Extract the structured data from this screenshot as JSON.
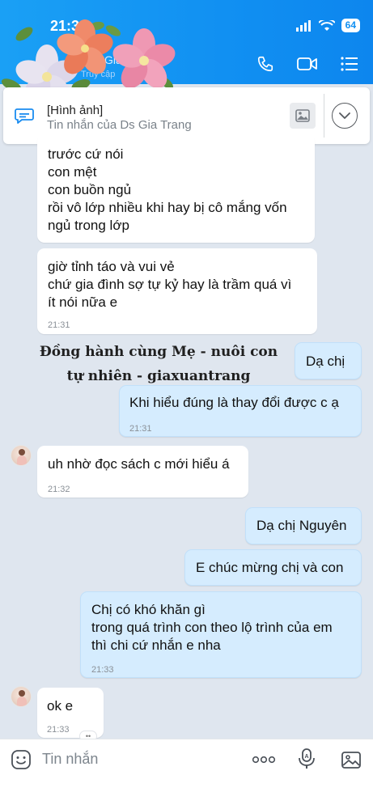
{
  "status": {
    "time": "21:3",
    "battery": "64"
  },
  "header": {
    "title": "Ds Gia",
    "subtitle": "Truy cập"
  },
  "pinned": {
    "title": "[Hình ảnh]",
    "subtitle": "Tin nhắn của Ds Gia Trang"
  },
  "watermark": {
    "line1": "Đồng hành cùng Mẹ - nuôi con",
    "line2": "tự nhiên - giaxuantrang"
  },
  "messages": [
    {
      "dir": "in",
      "lines": [
        "trước cứ nói",
        "con mệt",
        "con buồn ngủ",
        "rồi vô lớp nhiều khi hay bị cô mắng vốn",
        "ngủ trong lớp"
      ],
      "time": ""
    },
    {
      "dir": "in",
      "lines": [
        "giờ tỉnh táo và vui vẻ",
        "chứ gia đình sợ tự kỷ hay là trầm quá vì",
        "ít nói nữa e"
      ],
      "time": "21:31"
    },
    {
      "dir": "out",
      "lines": [
        "Dạ chị"
      ],
      "time": ""
    },
    {
      "dir": "out",
      "lines": [
        "Khi hiểu đúng là thay đổi được c ạ"
      ],
      "time": "21:31"
    },
    {
      "dir": "in",
      "lines": [
        "uh nhờ đọc sách c mới hiểu á"
      ],
      "time": "21:32"
    },
    {
      "dir": "out",
      "lines": [
        "Dạ chị Nguyên"
      ],
      "time": ""
    },
    {
      "dir": "out",
      "lines": [
        "E chúc mừng chị và con"
      ],
      "time": ""
    },
    {
      "dir": "out",
      "lines": [
        "Chị có khó khăn gì",
        "trong quá trình con theo lộ trình của em",
        "thì chi cứ nhắn e nha"
      ],
      "time": "21:33"
    },
    {
      "dir": "in",
      "lines": [
        "ok e"
      ],
      "time": "21:33"
    }
  ],
  "composer": {
    "placeholder": "Tin nhắn"
  },
  "icons": [
    "signal-icon",
    "wifi-icon",
    "phone-icon",
    "video-icon",
    "menu-icon",
    "chat-pin-icon",
    "image-icon",
    "chevron-down-icon",
    "emoji-icon",
    "more-icon",
    "mic-icon",
    "gallery-icon"
  ],
  "colors": {
    "header": "#1190f2",
    "outgoing": "#d5ecfe",
    "incoming": "#ffffff",
    "background": "#dfe6ef"
  }
}
